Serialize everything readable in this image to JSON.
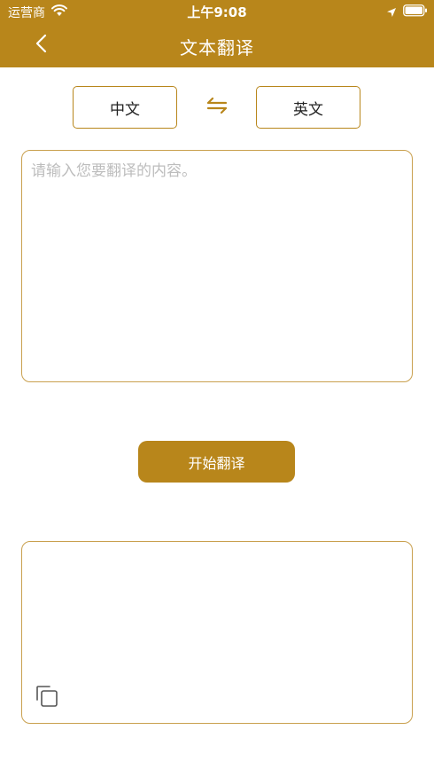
{
  "status_bar": {
    "carrier": "运营商",
    "time": "上午9:08"
  },
  "header": {
    "title": "文本翻译",
    "back_icon": "chevron-left-icon"
  },
  "languages": {
    "source": "中文",
    "target": "英文",
    "swap_icon": "swap-arrows-icon"
  },
  "input": {
    "value": "",
    "placeholder": "请输入您要翻译的内容。"
  },
  "actions": {
    "start_label": "开始翻译"
  },
  "output": {
    "value": "",
    "copy_icon": "copy-icon"
  },
  "colors": {
    "brand": "#b8861b",
    "border": "#c9a04e",
    "placeholder": "#bdbdbd"
  }
}
